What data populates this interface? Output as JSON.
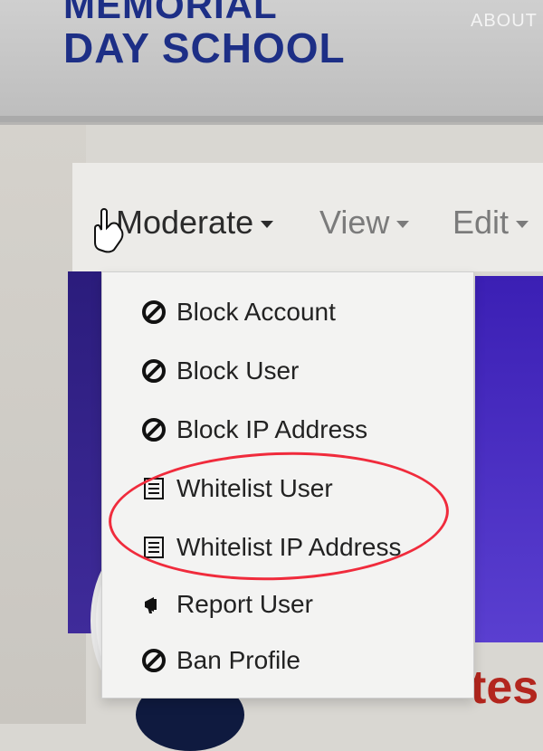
{
  "header": {
    "school_name_line1": "MEMORIAL",
    "school_name_line2": "DAY SCHOOL",
    "about_label": "ABOUT"
  },
  "toolbar": {
    "moderate_label": "Moderate",
    "view_label": "View",
    "edit_label": "Edit"
  },
  "dropdown": {
    "items": [
      {
        "label": "Block Account",
        "icon": "ban-icon"
      },
      {
        "label": "Block User",
        "icon": "ban-icon"
      },
      {
        "label": "Block IP Address",
        "icon": "ban-icon"
      },
      {
        "label": "Whitelist User",
        "icon": "list-icon"
      },
      {
        "label": "Whitelist IP Address",
        "icon": "list-icon"
      },
      {
        "label": "Report User",
        "icon": "megaphone-icon"
      },
      {
        "label": "Ban Profile",
        "icon": "ban-icon"
      }
    ]
  },
  "background": {
    "partial_red_text": "tes"
  },
  "colors": {
    "brand_blue": "#1d2f86",
    "highlight_red": "#f02b3c",
    "panel_blue": "#3f2b9a"
  }
}
